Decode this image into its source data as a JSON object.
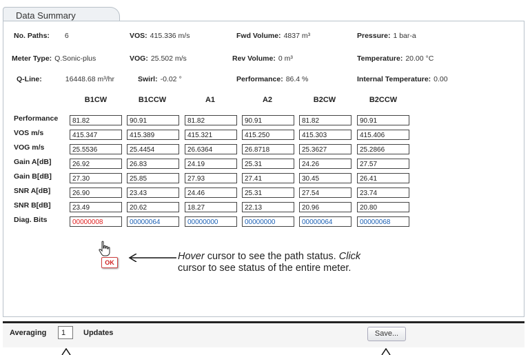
{
  "tab": {
    "label": "Data Summary"
  },
  "info": {
    "paths": {
      "label": "No. Paths:",
      "value": "6"
    },
    "vos": {
      "label": "VOS:",
      "value": "415.336 m/s"
    },
    "fwd_volume": {
      "label": "Fwd Volume:",
      "value": "4837 m³"
    },
    "pressure": {
      "label": "Pressure:",
      "value": "1 bar-a"
    },
    "meter_type": {
      "label": "Meter Type:",
      "value": "Q.Sonic-plus"
    },
    "vog": {
      "label": "VOG:",
      "value": "25.502 m/s"
    },
    "rev_volume": {
      "label": "Rev Volume:",
      "value": "0 m³"
    },
    "temperature": {
      "label": "Temperature:",
      "value": "20.00 °C"
    },
    "qline": {
      "label": "Q-Line:",
      "value": "16448.68 m³/hr"
    },
    "swirl": {
      "label": "Swirl:",
      "value": "-0.02 °"
    },
    "performance": {
      "label": "Performance:",
      "value": "86.4 %"
    },
    "internal_temp": {
      "label": "Internal Temperature:",
      "value": "0.00"
    }
  },
  "columns": [
    "B1CW",
    "B1CCW",
    "A1",
    "A2",
    "B2CW",
    "B2CCW"
  ],
  "rows": [
    {
      "label": "Performance",
      "values": [
        "81.82",
        "90.91",
        "81.82",
        "90.91",
        "81.82",
        "90.91"
      ]
    },
    {
      "label": "VOS m/s",
      "values": [
        "415.347",
        "415.389",
        "415.321",
        "415.250",
        "415.303",
        "415.406"
      ]
    },
    {
      "label": "VOG m/s",
      "values": [
        "25.5536",
        "25.4454",
        "26.6364",
        "26.8718",
        "25.3627",
        "25.2866"
      ]
    },
    {
      "label": "Gain A[dB]",
      "values": [
        "26.92",
        "26.83",
        "24.19",
        "25.31",
        "24.26",
        "27.57"
      ]
    },
    {
      "label": "Gain B[dB]",
      "values": [
        "27.30",
        "25.85",
        "27.93",
        "27.41",
        "30.45",
        "26.41"
      ]
    },
    {
      "label": "SNR A[dB]",
      "values": [
        "26.90",
        "23.43",
        "24.46",
        "25.31",
        "27.54",
        "23.74"
      ]
    },
    {
      "label": "SNR B[dB]",
      "values": [
        "23.49",
        "20.62",
        "18.27",
        "22.13",
        "20.96",
        "20.80"
      ]
    },
    {
      "label": "Diag. Bits",
      "values": [
        "00000008",
        "00000064",
        "00000000",
        "00000000",
        "00000064",
        "00000068"
      ]
    }
  ],
  "diag_status_colors": [
    "#e02020",
    "#1a5fb4",
    "#1a5fb4",
    "#1a5fb4",
    "#1a5fb4",
    "#1a5fb4"
  ],
  "tooltip": {
    "ok_label": "OK"
  },
  "annotation": {
    "hover_word": "Hover",
    "hover_text": " cursor to see the path status. ",
    "click_word": "Click",
    "click_text": " cursor to see status of the entire meter."
  },
  "footer": {
    "averaging_label": "Averaging",
    "averaging_value": "1",
    "updates_label": "Updates",
    "save_label": "Save..."
  }
}
